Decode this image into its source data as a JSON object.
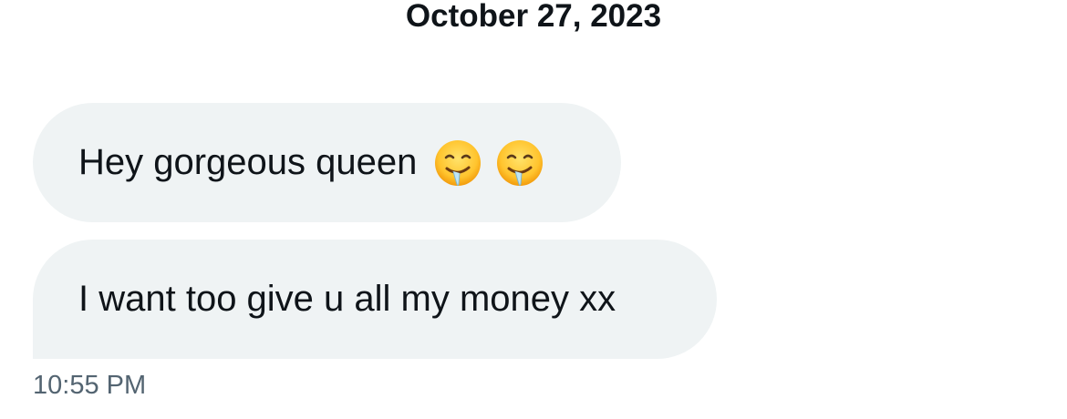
{
  "conversation": {
    "date": "October 27, 2023",
    "messages": [
      {
        "text": "Hey gorgeous queen",
        "emojis": [
          "drooling-face-icon",
          "drooling-face-icon"
        ]
      },
      {
        "text": "I want too give u all my money xx",
        "emojis": []
      }
    ],
    "timestamp": "10:55 PM"
  },
  "colors": {
    "bubble_background": "#eff3f4",
    "text_primary": "#0f1419",
    "text_secondary": "#536471"
  }
}
